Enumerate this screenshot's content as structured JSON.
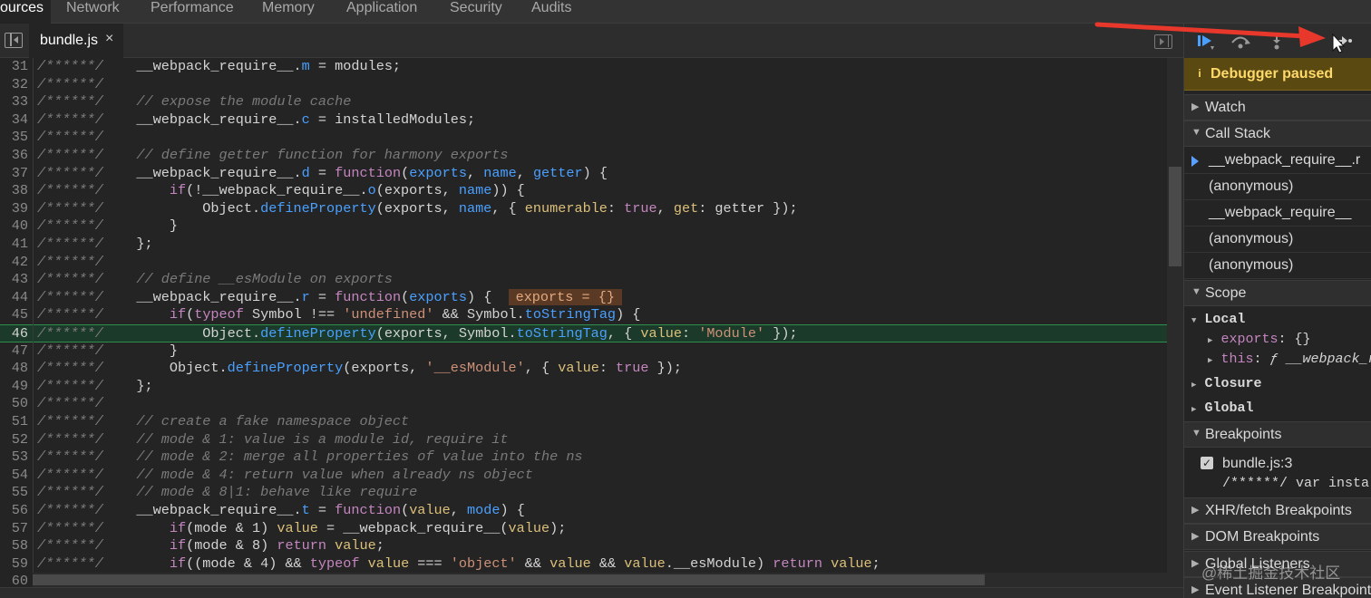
{
  "top_tabs": [
    {
      "label": "ources",
      "active": true
    },
    {
      "label": "Network"
    },
    {
      "label": "Performance"
    },
    {
      "label": "Memory"
    },
    {
      "label": "Application"
    },
    {
      "label": "Security"
    },
    {
      "label": "Audits"
    }
  ],
  "editor": {
    "file_tab": {
      "name": "bundle.js",
      "close": "×"
    },
    "lines": [
      {
        "n": "31",
        "code": "/******/    __webpack_require__.m = modules;"
      },
      {
        "n": "32",
        "code": "/******/"
      },
      {
        "n": "33",
        "code": "/******/    // expose the module cache"
      },
      {
        "n": "34",
        "code": "/******/    __webpack_require__.c = installedModules;"
      },
      {
        "n": "35",
        "code": "/******/"
      },
      {
        "n": "36",
        "code": "/******/    // define getter function for harmony exports"
      },
      {
        "n": "37",
        "code": "/******/    __webpack_require__.d = function(exports, name, getter) {"
      },
      {
        "n": "38",
        "code": "/******/        if(!__webpack_require__.o(exports, name)) {"
      },
      {
        "n": "39",
        "code": "/******/            Object.defineProperty(exports, name, { enumerable: true, get: getter });"
      },
      {
        "n": "40",
        "code": "/******/        }"
      },
      {
        "n": "41",
        "code": "/******/    };"
      },
      {
        "n": "42",
        "code": "/******/"
      },
      {
        "n": "43",
        "code": "/******/    // define __esModule on exports"
      },
      {
        "n": "44",
        "code": "/******/    __webpack_require__.r = function(exports) {  exports = {}"
      },
      {
        "n": "45",
        "code": "/******/        if(typeof Symbol !== 'undefined' && Symbol.toStringTag) {"
      },
      {
        "n": "46",
        "code": "/******/            Object.defineProperty(exports, Symbol.toStringTag, { value: 'Module' });"
      },
      {
        "n": "47",
        "code": "/******/        }"
      },
      {
        "n": "48",
        "code": "/******/        Object.defineProperty(exports, '__esModule', { value: true });"
      },
      {
        "n": "49",
        "code": "/******/    };"
      },
      {
        "n": "50",
        "code": "/******/"
      },
      {
        "n": "51",
        "code": "/******/    // create a fake namespace object"
      },
      {
        "n": "52",
        "code": "/******/    // mode & 1: value is a module id, require it"
      },
      {
        "n": "53",
        "code": "/******/    // mode & 2: merge all properties of value into the ns"
      },
      {
        "n": "54",
        "code": "/******/    // mode & 4: return value when already ns object"
      },
      {
        "n": "55",
        "code": "/******/    // mode & 8|1: behave like require"
      },
      {
        "n": "56",
        "code": "/******/    __webpack_require__.t = function(value, mode) {"
      },
      {
        "n": "57",
        "code": "/******/        if(mode & 1) value = __webpack_require__(value);"
      },
      {
        "n": "58",
        "code": "/******/        if(mode & 8) return value;"
      },
      {
        "n": "59",
        "code": "/******/        if((mode & 4) && typeof value === 'object' && value && value.__esModule) return value;"
      },
      {
        "n": "60",
        "code": ""
      }
    ],
    "current_line": "46",
    "inline_value": "exports = {}"
  },
  "sidebar": {
    "paused": {
      "icon": "i",
      "text": "Debugger paused"
    },
    "sections": {
      "watch": "Watch",
      "call_stack": "Call Stack",
      "scope": "Scope",
      "breakpoints": "Breakpoints",
      "xhr": "XHR/fetch Breakpoints",
      "dom": "DOM Breakpoints",
      "global_listeners": "Global Listeners",
      "event_listener": "Event Listener Breakpoints"
    },
    "call_stack": [
      "__webpack_require__.r",
      "(anonymous)",
      "__webpack_require__",
      "(anonymous)",
      "(anonymous)"
    ],
    "scope": {
      "local_label": "Local",
      "exports_key": "exports",
      "exports_val": "{}",
      "this_key": "this",
      "this_val": "ƒ __webpack_r",
      "closure_label": "Closure",
      "global_label": "Global"
    },
    "breakpoint": {
      "file": "bundle.js:3",
      "snippet": "/******/ var instal",
      "checked": true
    }
  },
  "watermark": "@稀土掘金技术社区",
  "colors": {
    "accent": "#4aa0ff",
    "paused_banner": "#5a4a12",
    "current_line": "#1c3a2a",
    "annotation_arrow": "#e8372b"
  }
}
